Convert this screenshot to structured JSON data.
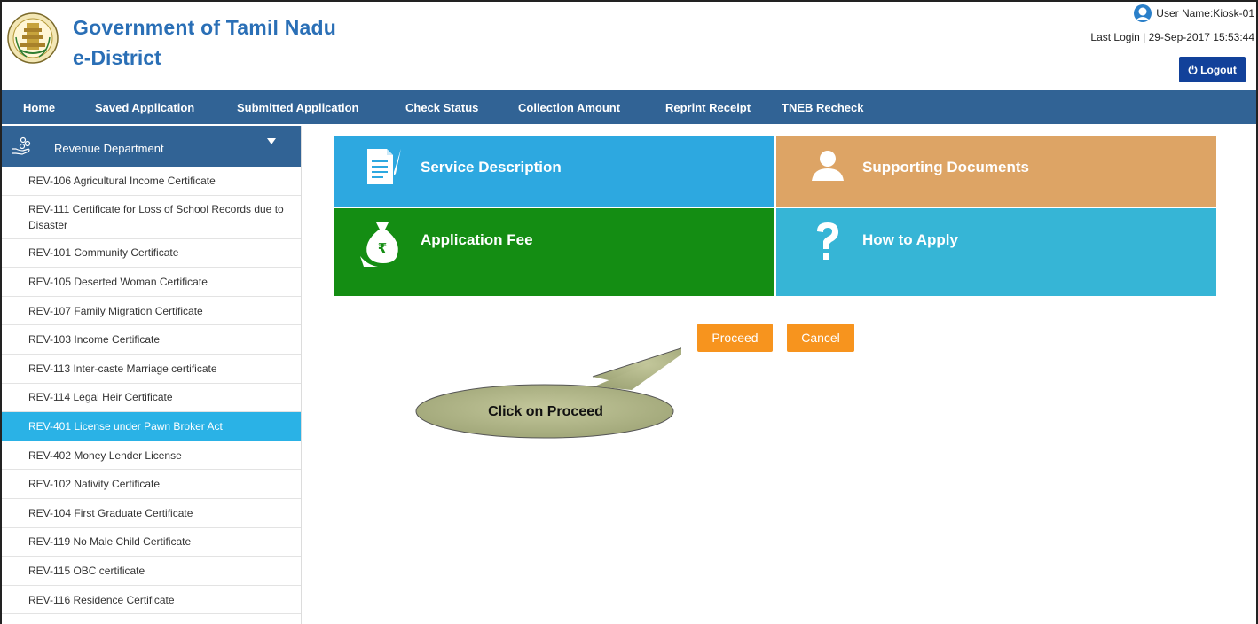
{
  "header": {
    "title": "Government of Tamil Nadu",
    "subtitle": "e-District",
    "user_name": "User Name:Kiosk-01",
    "last_login": "Last Login | 29-Sep-2017 15:53:44",
    "logout_label": "Logout"
  },
  "nav": {
    "items": [
      {
        "label": "Home"
      },
      {
        "label": "Saved Application"
      },
      {
        "label": "Submitted Application"
      },
      {
        "label": "Check Status"
      },
      {
        "label": "Collection Amount"
      },
      {
        "label": "Reprint Receipt"
      },
      {
        "label": "TNEB Recheck"
      }
    ]
  },
  "sidebar": {
    "department": "Revenue Department",
    "items": [
      {
        "label": "REV-106 Agricultural Income Certificate"
      },
      {
        "label": "REV-111 Certificate for Loss of School Records due to Disaster"
      },
      {
        "label": "REV-101 Community Certificate"
      },
      {
        "label": "REV-105 Deserted Woman Certificate"
      },
      {
        "label": "REV-107 Family Migration Certificate"
      },
      {
        "label": "REV-103 Income Certificate"
      },
      {
        "label": "REV-113 Inter-caste Marriage certificate"
      },
      {
        "label": "REV-114 Legal Heir Certificate"
      },
      {
        "label": "REV-401 License under Pawn Broker Act"
      },
      {
        "label": "REV-402 Money Lender License"
      },
      {
        "label": "REV-102 Nativity Certificate"
      },
      {
        "label": "REV-104 First Graduate Certificate"
      },
      {
        "label": "REV-119 No Male Child Certificate"
      },
      {
        "label": "REV-115 OBC certificate"
      },
      {
        "label": "REV-116 Residence Certificate"
      }
    ],
    "active_item": "REV-401 License under Pawn Broker Act"
  },
  "tiles": {
    "service_description": {
      "label": "Service Description",
      "icon": "document-pen-icon",
      "color": "#2da8e0"
    },
    "supporting_documents": {
      "label": "Supporting Documents",
      "icon": "person-icon",
      "color": "#dda465"
    },
    "application_fee": {
      "label": "Application Fee",
      "icon": "money-bag-icon",
      "color": "#148d13"
    },
    "how_to_apply": {
      "label": "How to Apply",
      "icon": "question-mark-icon",
      "color": "#36b5d6"
    }
  },
  "actions": {
    "proceed_label": "Proceed",
    "cancel_label": "Cancel",
    "button_color": "#f7941e"
  },
  "callout": {
    "text": "Click on Proceed"
  },
  "colors": {
    "nav_bg": "#316395",
    "brand": "#2a6fb6",
    "active_item": "#2ab2e6",
    "logout_bg": "#12419a"
  }
}
